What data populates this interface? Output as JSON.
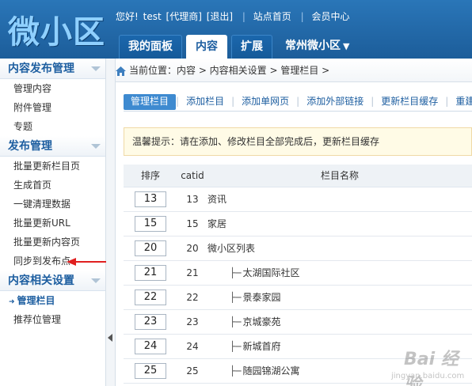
{
  "header": {
    "logo": "微小区",
    "greeting": "您好!",
    "username": "test",
    "role": "[代理商]",
    "logout": "[退出]",
    "site_home": "站点首页",
    "member_center": "会员中心"
  },
  "tabs": [
    {
      "label": "我的面板",
      "active": false
    },
    {
      "label": "内容",
      "active": true
    },
    {
      "label": "扩展",
      "active": false
    },
    {
      "label": "常州微小区",
      "active": false,
      "dropdown": true
    }
  ],
  "sidebar": {
    "groups": [
      {
        "title": "内容发布管理",
        "items": [
          "管理内容",
          "附件管理",
          "专题"
        ]
      },
      {
        "title": "发布管理",
        "items": [
          "批量更新栏目页",
          "生成首页",
          "一键清理数据",
          "批量更新URL",
          "批量更新内容页",
          "同步到发布点"
        ]
      },
      {
        "title": "内容相关设置",
        "items": [
          "管理栏目",
          "推荐位管理"
        ]
      }
    ],
    "active_item": "管理栏目"
  },
  "breadcrumb": "当前位置：内容 > 内容相关设置 > 管理栏目 >",
  "subnav": [
    "管理栏目",
    "添加栏目",
    "添加单网页",
    "添加外部链接",
    "更新栏目缓存",
    "重建"
  ],
  "notice": "温馨提示：请在添加、修改栏目全部完成后，更新栏目缓存",
  "table": {
    "headers": {
      "order": "排序",
      "catid": "catid",
      "name": "栏目名称"
    },
    "rows": [
      {
        "order": "13",
        "catid": "13",
        "name": "资讯",
        "child": false
      },
      {
        "order": "15",
        "catid": "15",
        "name": "家居",
        "child": false
      },
      {
        "order": "20",
        "catid": "20",
        "name": "微小区列表",
        "child": false
      },
      {
        "order": "21",
        "catid": "21",
        "name": "太湖国际社区",
        "child": true
      },
      {
        "order": "22",
        "catid": "22",
        "name": "景泰家园",
        "child": true
      },
      {
        "order": "23",
        "catid": "23",
        "name": "京城豪苑",
        "child": true
      },
      {
        "order": "24",
        "catid": "24",
        "name": "新城首府",
        "child": true
      },
      {
        "order": "25",
        "catid": "25",
        "name": "随园锦湖公寓",
        "child": true
      }
    ],
    "tree_prefix": "├─"
  },
  "watermark": {
    "text": "Bai 经验",
    "sub": "jingyan.baidu.com"
  },
  "colors": {
    "header": "#1f63a3",
    "accent": "#1d5ea0",
    "annotation_arrow": "#e02020"
  }
}
